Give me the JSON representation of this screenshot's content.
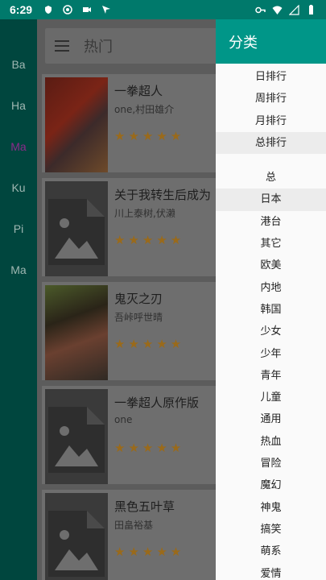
{
  "status": {
    "time": "6:29"
  },
  "rail": {
    "items": [
      {
        "label": "Ba"
      },
      {
        "label": "Ha"
      },
      {
        "label": "Ma"
      },
      {
        "label": "Ku"
      },
      {
        "label": "Pi"
      },
      {
        "label": "Ma"
      }
    ],
    "active_color": "#8b2a8a"
  },
  "appbar": {
    "title": "热门"
  },
  "comics": [
    {
      "title": "一拳超人",
      "author": "one,村田雄介",
      "stars": "★★★★★"
    },
    {
      "title": "关于我转生后成为",
      "author": "川上泰树,伏濑",
      "stars": "★★★★★"
    },
    {
      "title": "鬼灭之刃",
      "author": "吾峠呼世晴",
      "stars": "★★★★★"
    },
    {
      "title": "一拳超人原作版",
      "author": "one",
      "stars": "★★★★★"
    },
    {
      "title": "黑色五叶草",
      "author": "田畠裕基",
      "stars": "★★★★★"
    }
  ],
  "drawer": {
    "title": "分类",
    "rank_items": [
      {
        "label": "日排行"
      },
      {
        "label": "周排行"
      },
      {
        "label": "月排行"
      },
      {
        "label": "总排行"
      }
    ],
    "region_items": [
      {
        "label": "总"
      },
      {
        "label": "日本"
      },
      {
        "label": "港台"
      },
      {
        "label": "其它"
      },
      {
        "label": "欧美"
      },
      {
        "label": "内地"
      },
      {
        "label": "韩国"
      },
      {
        "label": "少女"
      },
      {
        "label": "少年"
      },
      {
        "label": "青年"
      },
      {
        "label": "儿童"
      },
      {
        "label": "通用"
      },
      {
        "label": "热血"
      },
      {
        "label": "冒险"
      },
      {
        "label": "魔幻"
      },
      {
        "label": "神鬼"
      },
      {
        "label": "搞笑"
      },
      {
        "label": "萌系"
      },
      {
        "label": "爱情"
      }
    ]
  },
  "colors": {
    "primary": "#009688",
    "status_bar": "#00796b",
    "star": "#f5a623"
  }
}
